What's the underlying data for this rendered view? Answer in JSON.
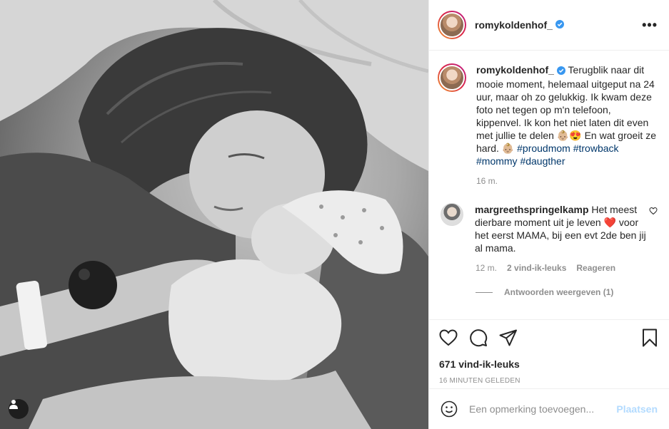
{
  "post": {
    "username": "romykoldenhof_",
    "verified": true,
    "caption": "Terugblik naar dit mooie moment, helemaal uitgeput na 24 uur, maar oh zo gelukkig. Ik kwam deze foto net tegen op m'n telefoon, kippenvel. Ik kon het niet laten dit even met jullie te delen 👶🏼😍 En wat groeit ze hard. 👶🏼",
    "hashtags": [
      "#proudmom",
      "#trowback",
      "#mommy",
      "#daugther"
    ],
    "time": "16 m.",
    "likes": "671 vind-ik-leuks",
    "posted": "16 MINUTEN GELEDEN"
  },
  "comment": {
    "username": "margreethspringelkamp",
    "text_1": "Het meest dierbare moment uit je leven",
    "heart": "❤️",
    "text_2": "voor het eerst MAMA, bij een evt 2de ben jij al mama.",
    "time": "12 m.",
    "likes": "2 vind-ik-leuks",
    "reply": "Reageren",
    "view_replies": "Antwoorden weergeven (1)"
  },
  "input": {
    "placeholder": "Een opmerking toevoegen...",
    "post_label": "Plaatsen"
  },
  "icons": {
    "more": "more-options-icon",
    "like": "heart-icon",
    "comment": "comment-icon",
    "share": "paper-plane-icon",
    "save": "bookmark-icon",
    "emoji": "smiley-icon",
    "tag": "user-tag-icon"
  },
  "colors": {
    "verified": "#3897f0",
    "hashtag": "#00376b",
    "muted": "#8e8e8e",
    "post_button": "#b3dbff"
  }
}
